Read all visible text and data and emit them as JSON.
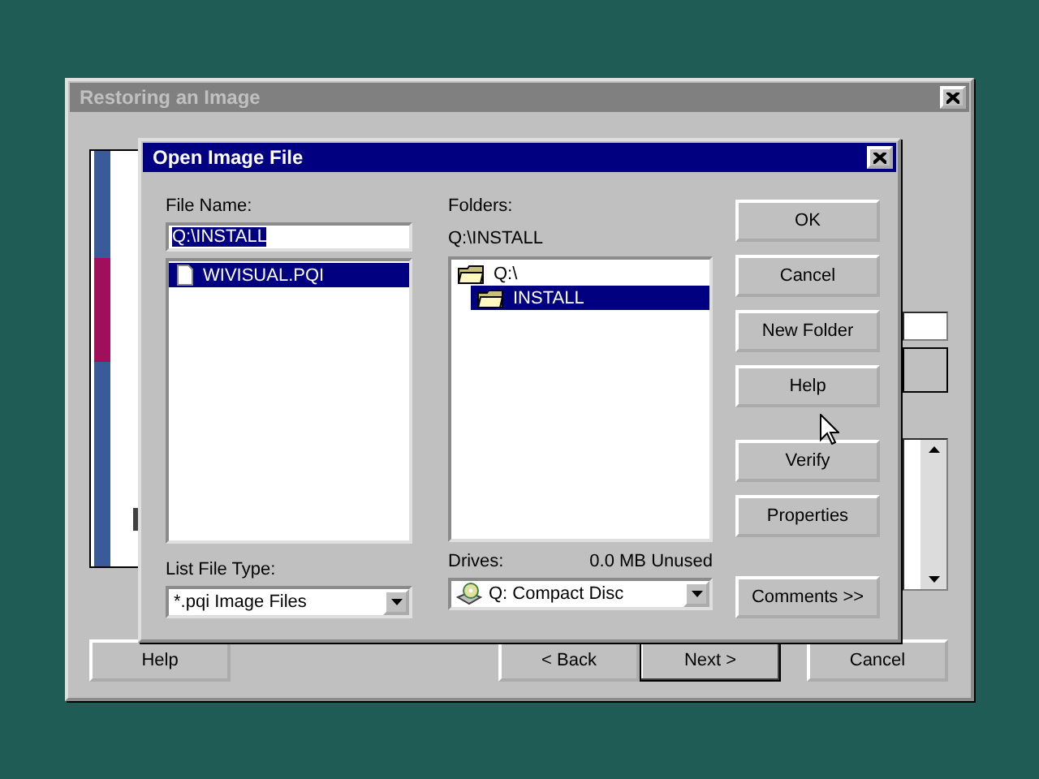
{
  "background_window": {
    "title": "Restoring an Image",
    "active": false,
    "buttons": [
      {
        "label": "Help",
        "default": false
      },
      {
        "label": "< Back",
        "default": false
      },
      {
        "label": "Next >",
        "default": true
      },
      {
        "label": "Cancel",
        "default": false
      }
    ]
  },
  "dialog": {
    "title": "Open Image File",
    "active": true,
    "file_name": {
      "label": "File Name:",
      "value": "Q:\\INSTALL",
      "text_selected": true
    },
    "files": [
      {
        "name": "WIVISUAL.PQI",
        "selected": true
      }
    ],
    "folders_label": {
      "label": "Folders:"
    },
    "current_path": "Q:\\INSTALL",
    "folders": [
      {
        "name": "Q:\\",
        "selected": false,
        "children": [
          {
            "name": "INSTALL",
            "selected": true
          }
        ]
      }
    ],
    "file_type": {
      "label": "List File Type:",
      "value": "*.pqi  Image Files"
    },
    "drives": {
      "label": "Drives:",
      "value": "Q:  Compact Disc",
      "free": "0.0 MB Unused"
    },
    "buttons": [
      {
        "label": "OK"
      },
      {
        "label": "Cancel"
      },
      {
        "label": "New Folder"
      },
      {
        "label": "Help"
      },
      {
        "label": "Verify"
      },
      {
        "label": "Properties"
      },
      {
        "label": "Comments >>"
      }
    ]
  }
}
